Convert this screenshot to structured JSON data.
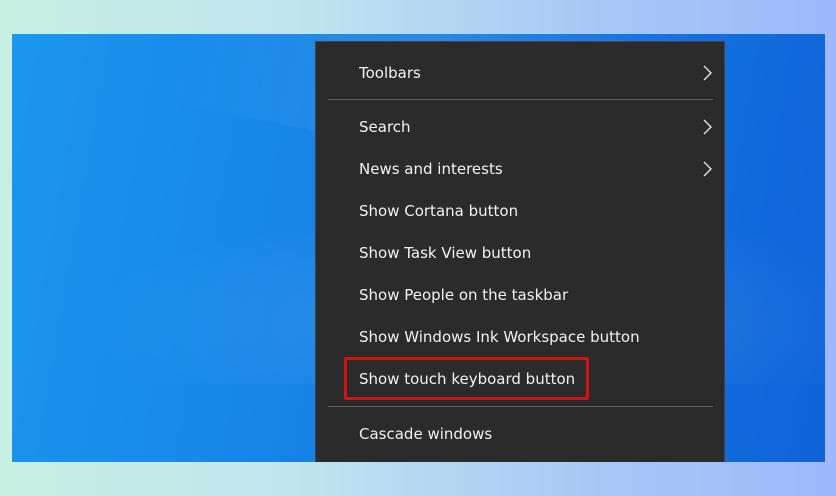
{
  "menu": {
    "items": [
      {
        "label": "Toolbars",
        "submenu": true
      },
      {
        "label": "Search",
        "submenu": true
      },
      {
        "label": "News and interests",
        "submenu": true
      },
      {
        "label": "Show Cortana button",
        "submenu": false
      },
      {
        "label": "Show Task View button",
        "submenu": false
      },
      {
        "label": "Show People on the taskbar",
        "submenu": false
      },
      {
        "label": "Show Windows Ink Workspace button",
        "submenu": false
      },
      {
        "label": "Show touch keyboard button",
        "submenu": false
      },
      {
        "label": "Cascade windows",
        "submenu": false
      }
    ]
  },
  "colors": {
    "menu_background": "#2b2b2b",
    "highlight_border": "#cf1414",
    "desktop_blue": "#1680e6"
  }
}
